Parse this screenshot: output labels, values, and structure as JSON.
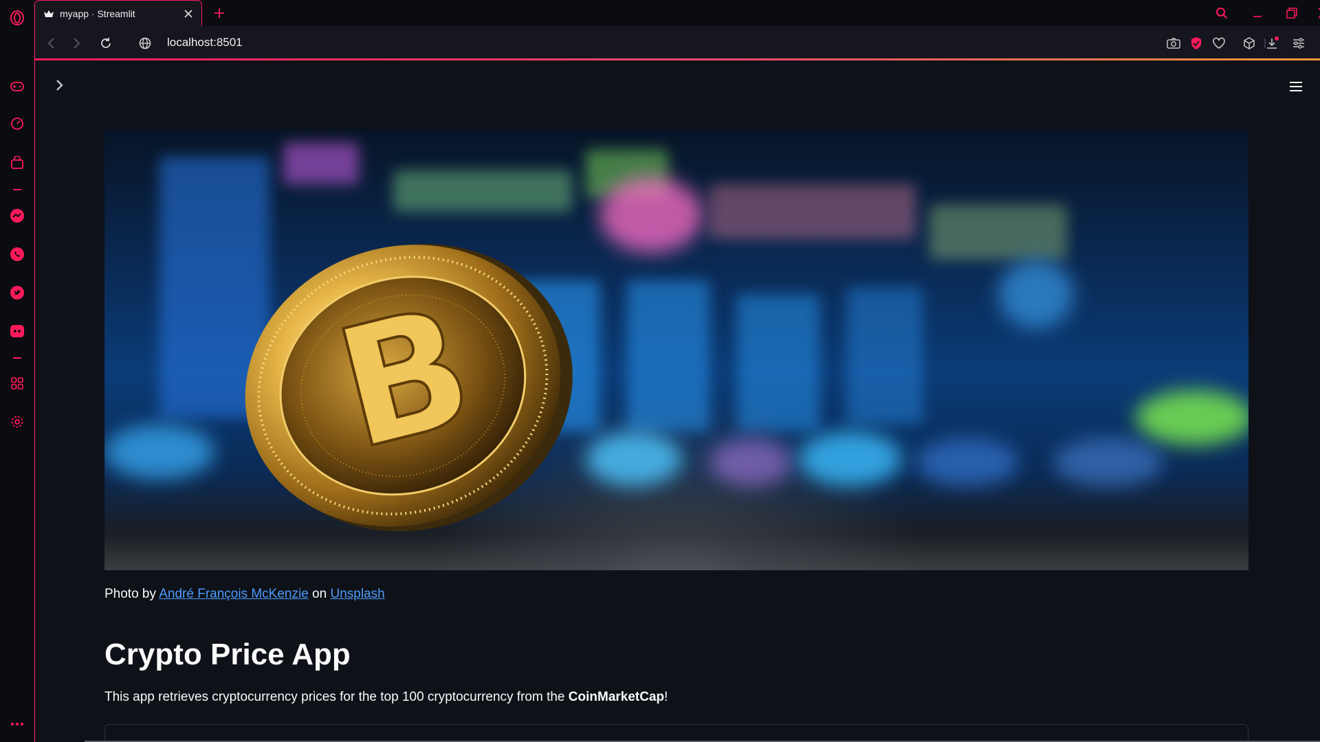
{
  "browser": {
    "tab_title": "myapp · Streamlit",
    "url": "localhost:8501",
    "accent": "#ff1b5a",
    "sidebar_icons": [
      "opera-logo-icon",
      "game-controller-icon",
      "speed-dial-icon",
      "bag-icon",
      "messenger-icon",
      "whatsapp-icon",
      "twitter-icon",
      "discord-icon",
      "extensions-grid-icon",
      "settings-gear-icon",
      "more-dots-icon"
    ],
    "toolbar_icons": [
      "snapshot-camera-icon",
      "adblock-shield-icon",
      "bookmark-heart-icon",
      "cube-icon",
      "download-icon",
      "easy-setup-icon"
    ]
  },
  "app": {
    "background": "#0e1117",
    "photo_credit": {
      "prefix": "Photo by ",
      "author": "André François McKenzie",
      "middle": " on ",
      "source": "Unsplash"
    },
    "title": "Crypto Price App",
    "description": {
      "prefix": "This app retrieves cryptocurrency prices for the top 100 cryptocurrency from the ",
      "strong": "CoinMarketCap",
      "suffix": "!"
    }
  }
}
